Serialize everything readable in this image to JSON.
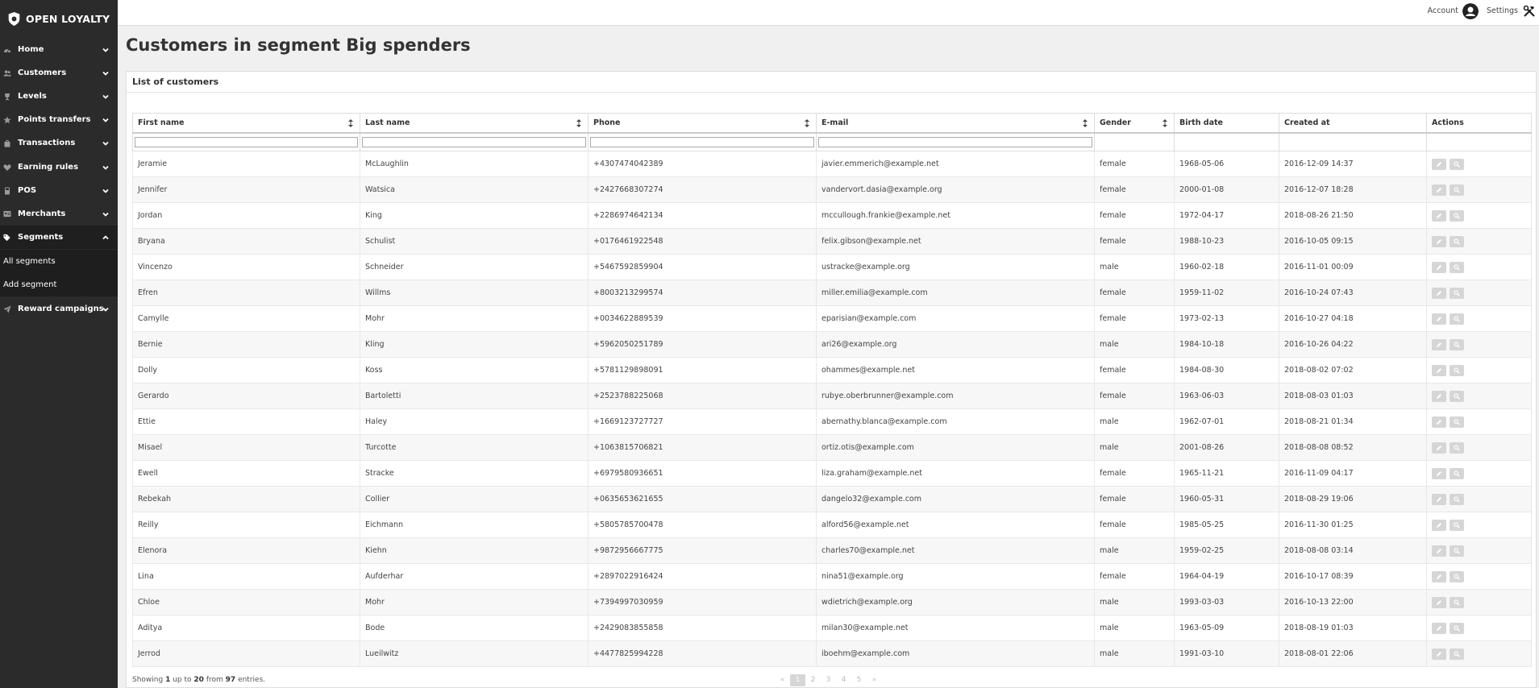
{
  "app": {
    "brand": "OPEN LOYALTY"
  },
  "topbar": {
    "account": "Account",
    "settings": "Settings"
  },
  "sidebar": {
    "items": [
      {
        "label": "Home",
        "icon": "dashboard-icon"
      },
      {
        "label": "Customers",
        "icon": "users-icon"
      },
      {
        "label": "Levels",
        "icon": "trophy-icon"
      },
      {
        "label": "Points transfers",
        "icon": "star-icon"
      },
      {
        "label": "Transactions",
        "icon": "shopping-bag-icon"
      },
      {
        "label": "Earning rules",
        "icon": "heart-icon"
      },
      {
        "label": "POS",
        "icon": "pos-terminal-icon"
      },
      {
        "label": "Merchants",
        "icon": "id-card-icon"
      },
      {
        "label": "Segments",
        "icon": "tags-icon"
      },
      {
        "label": "Reward campaigns",
        "icon": "paper-plane-icon"
      }
    ],
    "segments_sub": [
      "All segments",
      "Add segment"
    ]
  },
  "page": {
    "title": "Customers in segment Big spenders"
  },
  "panel": {
    "title": "List of customers"
  },
  "table": {
    "columns": [
      "First name",
      "Last name",
      "Phone",
      "E-mail",
      "Gender",
      "Birth date",
      "Created at",
      "Actions"
    ],
    "rows": [
      [
        "Jeramie",
        "McLaughlin",
        "+4307474042389",
        "javier.emmerich@example.net",
        "female",
        "1968-05-06",
        "2016-12-09 14:37"
      ],
      [
        "Jennifer",
        "Watsica",
        "+2427668307274",
        "vandervort.dasia@example.org",
        "female",
        "2000-01-08",
        "2016-12-07 18:28"
      ],
      [
        "Jordan",
        "King",
        "+2286974642134",
        "mccullough.frankie@example.net",
        "female",
        "1972-04-17",
        "2018-08-26 21:50"
      ],
      [
        "Bryana",
        "Schulist",
        "+0176461922548",
        "felix.gibson@example.net",
        "female",
        "1988-10-23",
        "2016-10-05 09:15"
      ],
      [
        "Vincenzo",
        "Schneider",
        "+5467592859904",
        "ustracke@example.org",
        "male",
        "1960-02-18",
        "2016-11-01 00:09"
      ],
      [
        "Efren",
        "Willms",
        "+8003213299574",
        "miller.emilia@example.com",
        "female",
        "1959-11-02",
        "2016-10-24 07:43"
      ],
      [
        "Camylle",
        "Mohr",
        "+0034622889539",
        "eparisian@example.com",
        "female",
        "1973-02-13",
        "2016-10-27 04:18"
      ],
      [
        "Bernie",
        "Kling",
        "+5962050251789",
        "ari26@example.org",
        "male",
        "1984-10-18",
        "2016-10-26 04:22"
      ],
      [
        "Dolly",
        "Koss",
        "+5781129898091",
        "ohammes@example.net",
        "female",
        "1984-08-30",
        "2018-08-02 07:02"
      ],
      [
        "Gerardo",
        "Bartoletti",
        "+2523788225068",
        "rubye.oberbrunner@example.com",
        "female",
        "1963-06-03",
        "2018-08-03 01:03"
      ],
      [
        "Ettie",
        "Haley",
        "+1669123727727",
        "abernathy.blanca@example.com",
        "male",
        "1962-07-01",
        "2018-08-21 01:34"
      ],
      [
        "Misael",
        "Turcotte",
        "+1063815706821",
        "ortiz.otis@example.com",
        "male",
        "2001-08-26",
        "2018-08-08 08:52"
      ],
      [
        "Ewell",
        "Stracke",
        "+6979580936651",
        "liza.graham@example.net",
        "female",
        "1965-11-21",
        "2016-11-09 04:17"
      ],
      [
        "Rebekah",
        "Collier",
        "+0635653621655",
        "dangelo32@example.com",
        "female",
        "1960-05-31",
        "2018-08-29 19:06"
      ],
      [
        "Reilly",
        "Eichmann",
        "+5805785700478",
        "alford56@example.net",
        "female",
        "1985-05-25",
        "2016-11-30 01:25"
      ],
      [
        "Elenora",
        "Kiehn",
        "+9872956667775",
        "charles70@example.net",
        "male",
        "1959-02-25",
        "2018-08-08 03:14"
      ],
      [
        "Lina",
        "Aufderhar",
        "+2897022916424",
        "nina51@example.org",
        "female",
        "1964-04-19",
        "2016-10-17 08:39"
      ],
      [
        "Chloe",
        "Mohr",
        "+7394997030959",
        "wdietrich@example.org",
        "male",
        "1993-03-03",
        "2016-10-13 22:00"
      ],
      [
        "Aditya",
        "Bode",
        "+2429083855858",
        "milan30@example.net",
        "male",
        "1963-05-09",
        "2018-08-19 01:03"
      ],
      [
        "Jerrod",
        "Lueilwitz",
        "+4477825994228",
        "iboehm@example.com",
        "male",
        "1991-03-10",
        "2018-08-01 22:06"
      ]
    ]
  },
  "footer": {
    "showing": "Showing",
    "from_num": "1",
    "up_to": "up to",
    "to_num": "20",
    "from_word": "from",
    "total": "97",
    "entries": "entries."
  },
  "pagination": {
    "prev": "«",
    "pages": [
      "1",
      "2",
      "3",
      "4",
      "5"
    ],
    "next": "»",
    "current": "1"
  }
}
